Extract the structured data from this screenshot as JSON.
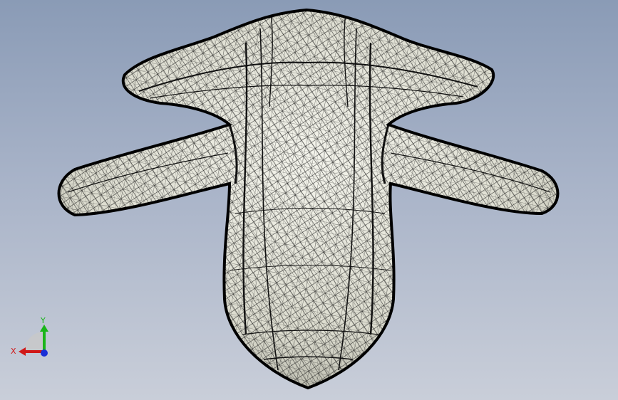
{
  "viewport": {
    "model": "wireframe-mesh-part",
    "colors": {
      "background_top": "#8a9bb6",
      "background_bottom": "#c9ced9",
      "model_fill": "#e6e6dc",
      "mesh_line": "#111111"
    }
  },
  "triad": {
    "x_label": "X",
    "y_label": "Y",
    "colors": {
      "x": "#d01818",
      "y": "#19b519",
      "z": "#1a2fd6"
    }
  }
}
